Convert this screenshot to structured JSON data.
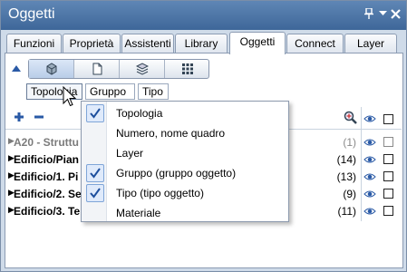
{
  "window": {
    "title": "Oggetti",
    "pin_icon": "pin-icon",
    "dropdown_icon": "chevron-down-icon",
    "close_icon": "close-icon"
  },
  "tabs": [
    {
      "label": "Funzioni"
    },
    {
      "label": "Proprietà"
    },
    {
      "label": "Assistenti"
    },
    {
      "label": "Library"
    },
    {
      "label": "Oggetti",
      "active": true
    },
    {
      "label": "Connect"
    },
    {
      "label": "Layer"
    }
  ],
  "viewbar": {
    "buttons": [
      {
        "icon": "cube-structure-icon",
        "selected": true
      },
      {
        "icon": "document-icon"
      },
      {
        "icon": "layers-icon"
      },
      {
        "icon": "grid-icon"
      }
    ]
  },
  "subtabs": [
    {
      "label": "Topologia"
    },
    {
      "label": "Gruppo"
    },
    {
      "label": "Tipo"
    }
  ],
  "tree": {
    "rows": [
      {
        "name": "A20 - Struttu",
        "count": "(1)",
        "grey": true
      },
      {
        "name": "Edificio/Pian",
        "count": "(14)"
      },
      {
        "name": "Edificio/1. Pi",
        "count": "(13)"
      },
      {
        "name": "Edificio/2. Se",
        "count": "(9)"
      },
      {
        "name": "Edificio/3. Te",
        "count": "(11)"
      }
    ]
  },
  "context_menu": {
    "items": [
      {
        "label": "Topologia",
        "checked": true
      },
      {
        "label": "Numero, nome quadro",
        "checked": false
      },
      {
        "label": "Layer",
        "checked": false
      },
      {
        "label": "Gruppo (gruppo oggetto)",
        "checked": true
      },
      {
        "label": "Tipo (tipo oggetto)",
        "checked": true
      },
      {
        "label": "Materiale",
        "checked": false
      }
    ]
  },
  "colors": {
    "titlebar": "#3e6799",
    "accent": "#2a5aa6"
  }
}
